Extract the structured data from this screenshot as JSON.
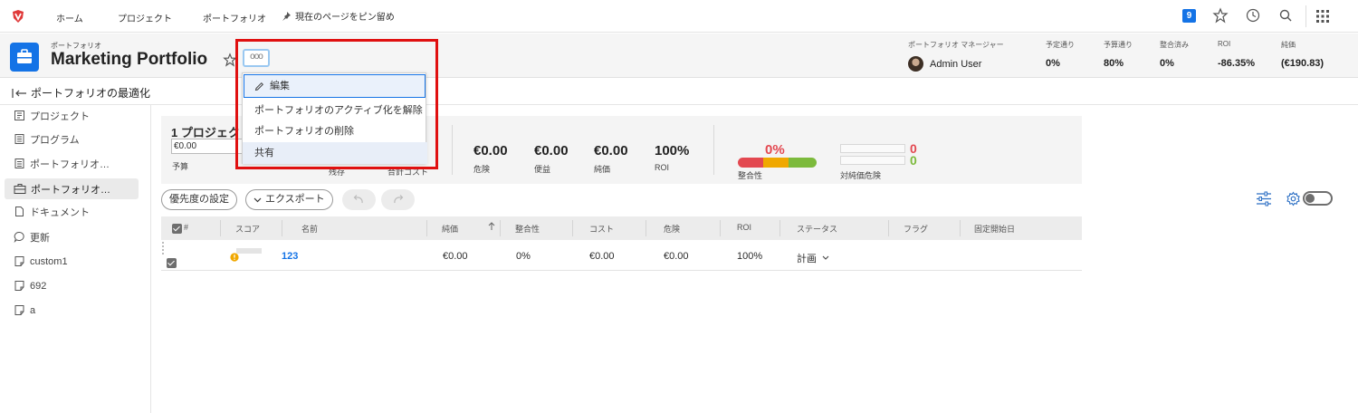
{
  "topnav": {
    "home": "ホーム",
    "projects": "プロジェクト",
    "portfolios": "ポートフォリオ",
    "pin": "現在のページをピン留め",
    "notification_count": "9"
  },
  "header": {
    "subtitle": "ポートフォリオ",
    "title": "Marketing Portfolio",
    "more": "ooo",
    "manager_label": "ポートフォリオ マネージャー",
    "manager_name": "Admin User",
    "stats": [
      {
        "label": "予定通り",
        "value": "0%"
      },
      {
        "label": "予算通り",
        "value": "80%"
      },
      {
        "label": "整合済み",
        "value": "0%"
      },
      {
        "label": "ROI",
        "value": "-86.35%"
      },
      {
        "label": "純価",
        "value": "(€190.83)"
      }
    ]
  },
  "optimize": {
    "label": "ポートフォリオの最適化"
  },
  "sidebar": {
    "items": [
      {
        "label": "プロジェクト"
      },
      {
        "label": "プログラム"
      },
      {
        "label": "ポートフォリオ…"
      },
      {
        "label": "ポートフォリオ…"
      },
      {
        "label": "ドキュメント"
      },
      {
        "label": "更新"
      },
      {
        "label": "custom1"
      },
      {
        "label": "692"
      },
      {
        "label": "a"
      }
    ]
  },
  "summary": {
    "title": "1 プロジェクト",
    "budget_value": "€0.00",
    "budget_label": "予算",
    "label_2": "残存",
    "label_3": "合計コスト",
    "metrics": [
      {
        "value": "€0.00",
        "label": "危険"
      },
      {
        "value": "€0.00",
        "label": "便益"
      },
      {
        "value": "€0.00",
        "label": "純価"
      },
      {
        "value": "100%",
        "label": "ROI"
      }
    ],
    "alignment_pct": "0%",
    "alignment_label": "整合性",
    "risk_top": "0",
    "risk_bottom": "0",
    "risk_label": "対純価危険"
  },
  "toolbar": {
    "priority": "優先度の設定",
    "export": "エクスポート"
  },
  "grid": {
    "headers": {
      "num": "#",
      "score": "スコア",
      "name": "名前",
      "net_value": "純価",
      "alignment": "整合性",
      "cost": "コスト",
      "risk": "危険",
      "roi": "ROI",
      "status": "ステータス",
      "flag": "フラグ",
      "fixed_start": "固定開始日"
    },
    "rows": [
      {
        "name": "123",
        "net_value": "€0.00",
        "alignment": "0%",
        "cost": "€0.00",
        "risk": "€0.00",
        "roi": "100%",
        "status": "計画"
      }
    ]
  },
  "menu": {
    "items": [
      {
        "label": "編集"
      },
      {
        "label": "ポートフォリオのアクティブ化を解除"
      },
      {
        "label": "ポートフォリオの削除"
      },
      {
        "label": "共有"
      }
    ]
  },
  "colors": {
    "accent": "#1473e6",
    "highlight": "#e01010",
    "alignment_bar": [
      "#e34850",
      "#f0a800",
      "#7cba3c"
    ]
  }
}
